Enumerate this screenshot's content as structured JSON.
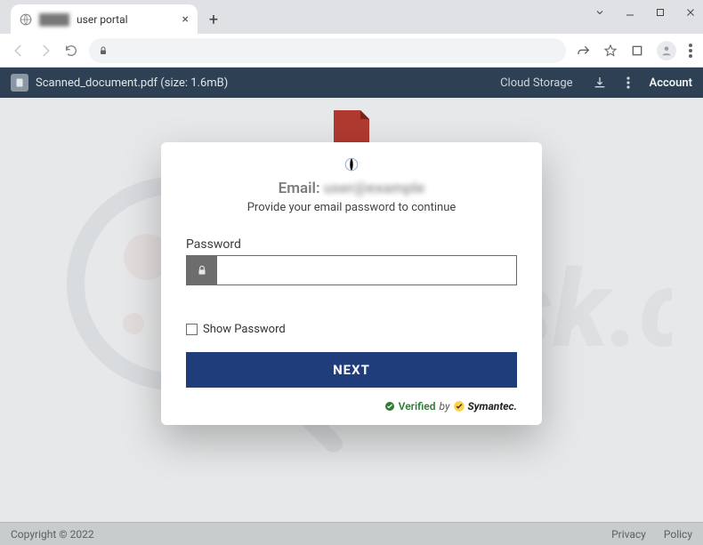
{
  "browser": {
    "tab": {
      "title_blur": "user",
      "title_suffix": "user portal"
    },
    "nav": {
      "back": "",
      "forward": "",
      "reload": ""
    }
  },
  "topbar": {
    "doc_label": "Scanned_document.pdf (size: 1.6mB)",
    "cloud_label": "Cloud Storage",
    "account_label": "Account"
  },
  "modal": {
    "email_label": "Email:",
    "email_value_blur": "user@example",
    "subtitle": "Provide your email password to continue",
    "password_label": "Password",
    "password_value": "",
    "show_password_label": "Show Password",
    "next_label": "NEXT",
    "verified_label": "Verified",
    "verified_by": "by",
    "verified_brand": "Symantec."
  },
  "watermark_text": "PCrisk.com",
  "footer": {
    "copyright": "Copyright © 2022",
    "link_privacy": "Privacy",
    "link_policy": "Policy"
  }
}
